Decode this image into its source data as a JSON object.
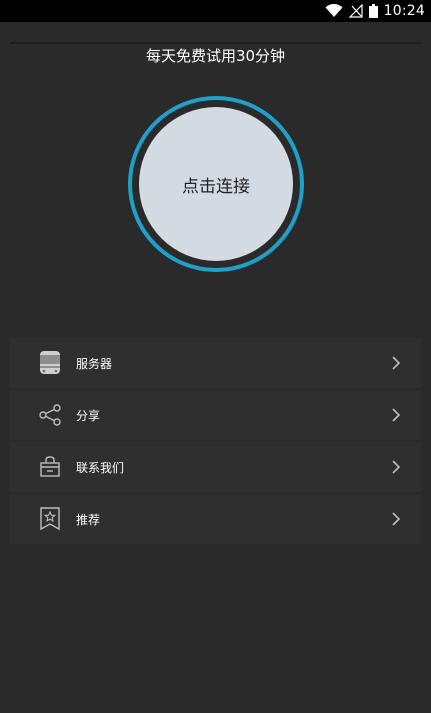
{
  "status_bar": {
    "time": "10:24",
    "icons": [
      "wifi-icon",
      "no-signal-icon",
      "battery-icon"
    ]
  },
  "header": {
    "trial_text": "每天免费试用30分钟"
  },
  "connect": {
    "label": "点击连接",
    "ring_color": "#1ea0c8",
    "button_color": "#d4dae2"
  },
  "menu": {
    "items": [
      {
        "label": "服务器",
        "icon": "server-icon"
      },
      {
        "label": "分享",
        "icon": "share-icon"
      },
      {
        "label": "联系我们",
        "icon": "contact-bag-icon"
      },
      {
        "label": "推荐",
        "icon": "recommend-bookmark-star-icon"
      }
    ]
  },
  "colors": {
    "background": "#2a2a2a",
    "menu_item_background": "#2f2f2f",
    "status_bar": "#000000",
    "accent": "#1ea0c8"
  }
}
